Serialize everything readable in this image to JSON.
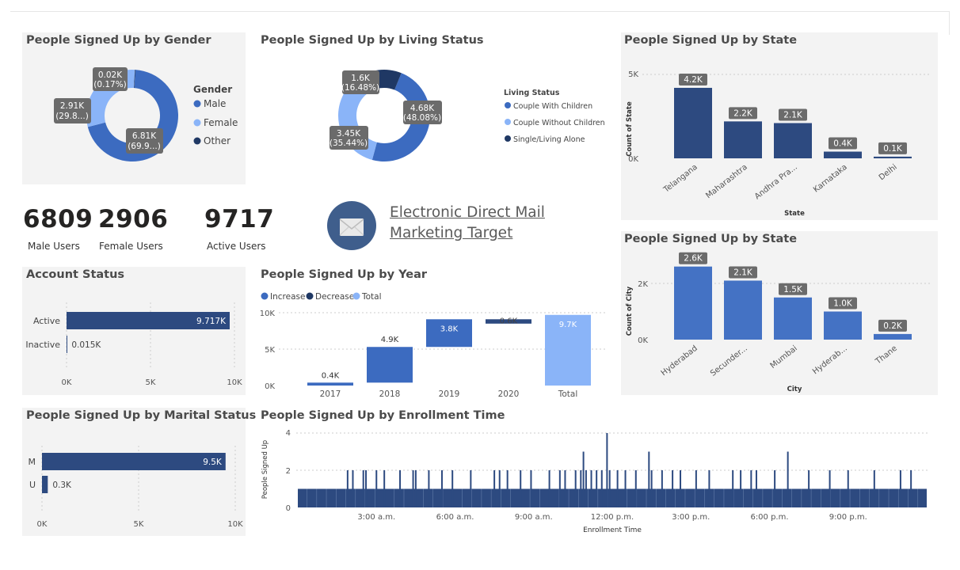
{
  "colors": {
    "dark_navy": "#1f3864",
    "navy": "#2d4a80",
    "blue": "#3c6bc0",
    "mid_blue": "#4472c4",
    "light_blue": "#8ab4f8",
    "panel_bg": "#f3f3f3",
    "label_bg": "#6b6b6b"
  },
  "gender": {
    "title": "People Signed Up by Gender",
    "legend_title": "Gender",
    "legend": [
      "Male",
      "Female",
      "Other"
    ],
    "labels": [
      {
        "l1": "0.02K",
        "l2": "(0.17%)"
      },
      {
        "l1": "2.91K",
        "l2": "(29.8...)"
      },
      {
        "l1": "6.81K",
        "l2": "(69.9...)"
      }
    ]
  },
  "living": {
    "title": "People Signed Up by Living Status",
    "legend_title": "Living Status",
    "legend": [
      "Couple With Children",
      "Couple Without Children",
      "Single/Living Alone"
    ],
    "labels": [
      {
        "l1": "1.6K",
        "l2": "(16.48%)"
      },
      {
        "l1": "4.68K",
        "l2": "(48.08%)"
      },
      {
        "l1": "3.45K",
        "l2": "(35.44%)"
      }
    ]
  },
  "state": {
    "title": "People Signed Up by State",
    "ylabel": "Count of State",
    "xlabel": "State",
    "yticks": [
      "5K",
      "0K"
    ]
  },
  "city": {
    "title": "People Signed Up by State",
    "ylabel": "Count of City",
    "xlabel": "City",
    "yticks": [
      "2K",
      "0K"
    ]
  },
  "kpis": [
    {
      "value": "6809",
      "label": "Male Users"
    },
    {
      "value": "2906",
      "label": "Female Users"
    },
    {
      "value": "9717",
      "label": "Active Users"
    }
  ],
  "mail": {
    "line1": "Electronic Direct Mail ",
    "line2": "Marketing Target"
  },
  "account": {
    "title": "Account Status",
    "xticks": [
      "0K",
      "5K",
      "10K"
    ]
  },
  "year": {
    "title": "People Signed Up by Year",
    "legend": [
      "Increase",
      "Decrease",
      "Total"
    ],
    "yticks": [
      "10K",
      "5K",
      "0K"
    ]
  },
  "marital": {
    "title": "People Signed Up by Marital Status",
    "xticks": [
      "0K",
      "5K",
      "10K"
    ]
  },
  "enrollment": {
    "title": "People Signed Up by Enrollment Time",
    "ylabel": "People Signed Up",
    "xlabel": "Enrollment Time",
    "yticks": [
      "4",
      "2",
      "0"
    ],
    "xticks": [
      "3:00 a.m.",
      "6:00 a.m.",
      "9:00 a.m.",
      "12:00 p.m.",
      "3:00 p.m.",
      "6:00 p.m.",
      "9:00 p.m."
    ]
  },
  "chart_data": [
    {
      "type": "pie",
      "title": "People Signed Up by Gender",
      "categories": [
        "Male",
        "Female",
        "Other"
      ],
      "values": [
        6810,
        2910,
        20
      ],
      "labels": [
        "6.81K",
        "2.91K",
        "0.02K"
      ]
    },
    {
      "type": "pie",
      "title": "People Signed Up by Living Status",
      "categories": [
        "Couple With Children",
        "Couple Without Children",
        "Single/Living Alone"
      ],
      "values": [
        4680,
        3450,
        1600
      ],
      "labels": [
        "4.68K",
        "3.45K",
        "1.6K"
      ]
    },
    {
      "type": "bar",
      "title": "People Signed Up by State",
      "categories": [
        "Telangana",
        "Maharashtra",
        "Andhra Pra...",
        "Karnataka",
        "Delhi"
      ],
      "values": [
        4200,
        2200,
        2100,
        400,
        100
      ],
      "labels": [
        "4.2K",
        "2.2K",
        "2.1K",
        "0.4K",
        "0.1K"
      ],
      "ylim": [
        0,
        5000
      ]
    },
    {
      "type": "bar",
      "title": "People Signed Up by State",
      "categories": [
        "Hyderabad",
        "Secunder...",
        "Mumbai",
        "Hyderab...",
        "Thane"
      ],
      "values": [
        2600,
        2100,
        1500,
        1000,
        200
      ],
      "labels": [
        "2.6K",
        "2.1K",
        "1.5K",
        "1.0K",
        "0.2K"
      ],
      "ylim": [
        0,
        2000
      ]
    },
    {
      "type": "bar",
      "title": "Account Status",
      "orientation": "horizontal",
      "categories": [
        "Active",
        "Inactive"
      ],
      "values": [
        9717,
        15
      ],
      "labels": [
        "9.717K",
        "0.015K"
      ],
      "xlim": [
        0,
        10000
      ]
    },
    {
      "type": "bar",
      "title": "People Signed Up by Year",
      "subtype": "waterfall",
      "categories": [
        "2017",
        "2018",
        "2019",
        "2020",
        "Total"
      ],
      "values": [
        400,
        4900,
        3800,
        600,
        9700
      ],
      "labels": [
        "0.4K",
        "4.9K",
        "3.8K",
        "0.6K",
        "9.7K"
      ],
      "ylim": [
        0,
        10000
      ]
    },
    {
      "type": "bar",
      "title": "People Signed Up by Marital Status",
      "orientation": "horizontal",
      "categories": [
        "M",
        "U"
      ],
      "values": [
        9500,
        300
      ],
      "labels": [
        "9.5K",
        "0.3K"
      ],
      "xlim": [
        0,
        10000
      ]
    },
    {
      "type": "bar",
      "title": "People Signed Up by Enrollment Time",
      "ylim": [
        0,
        4
      ],
      "spikes_at_2_hours": [
        1.9,
        2.1,
        2.5,
        2.6,
        3.0,
        3.3,
        3.9,
        4.4,
        4.5,
        5.0,
        5.5,
        5.9,
        6.6,
        7.5,
        7.7,
        8.0,
        8.5,
        8.9,
        9.6,
        10.0,
        10.2,
        10.6,
        10.8,
        11.0,
        11.2,
        11.4,
        11.6,
        11.9,
        12.2,
        12.5,
        12.9,
        13.5,
        13.9,
        14.3,
        14.6,
        15.2,
        15.7,
        16.6,
        16.9,
        17.3,
        17.5,
        18.2,
        19.5,
        20.3,
        21.0,
        22.0,
        23.0,
        23.4
      ],
      "spikes_at_3_hours": [
        10.9,
        13.4,
        18.7
      ],
      "spikes_at_4_hours": [
        11.8
      ],
      "baseline": 1
    }
  ]
}
